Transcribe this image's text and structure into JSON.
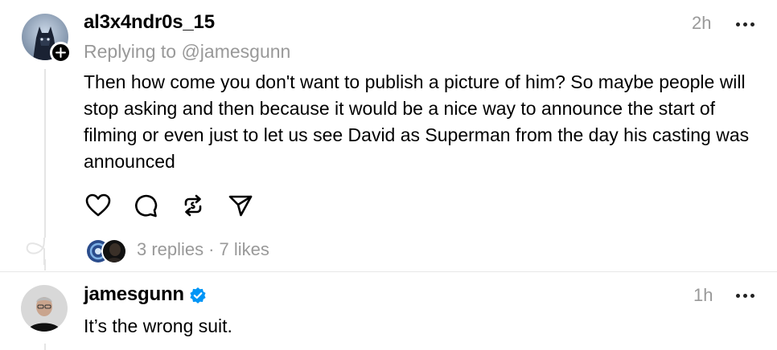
{
  "post": {
    "username": "al3x4ndr0s_15",
    "replying_to": "Replying to @jamesgunn",
    "time": "2h",
    "text": "Then how come you don't want to publish a picture of him? So maybe people will stop asking and then because it would be a nice way to announce the start of filming or even just to let us see David as Superman from the day his casting was announced",
    "actions": [
      "heart-icon",
      "comment-icon",
      "repost-icon",
      "share-icon"
    ],
    "replies": "3 replies",
    "separator": "·",
    "likes": "7 likes"
  },
  "reply": {
    "username": "jamesgunn",
    "verified": true,
    "time": "1h",
    "text": "It’s the wrong suit."
  },
  "colors": {
    "muted": "#999999",
    "verified_blue": "#0095f6"
  }
}
